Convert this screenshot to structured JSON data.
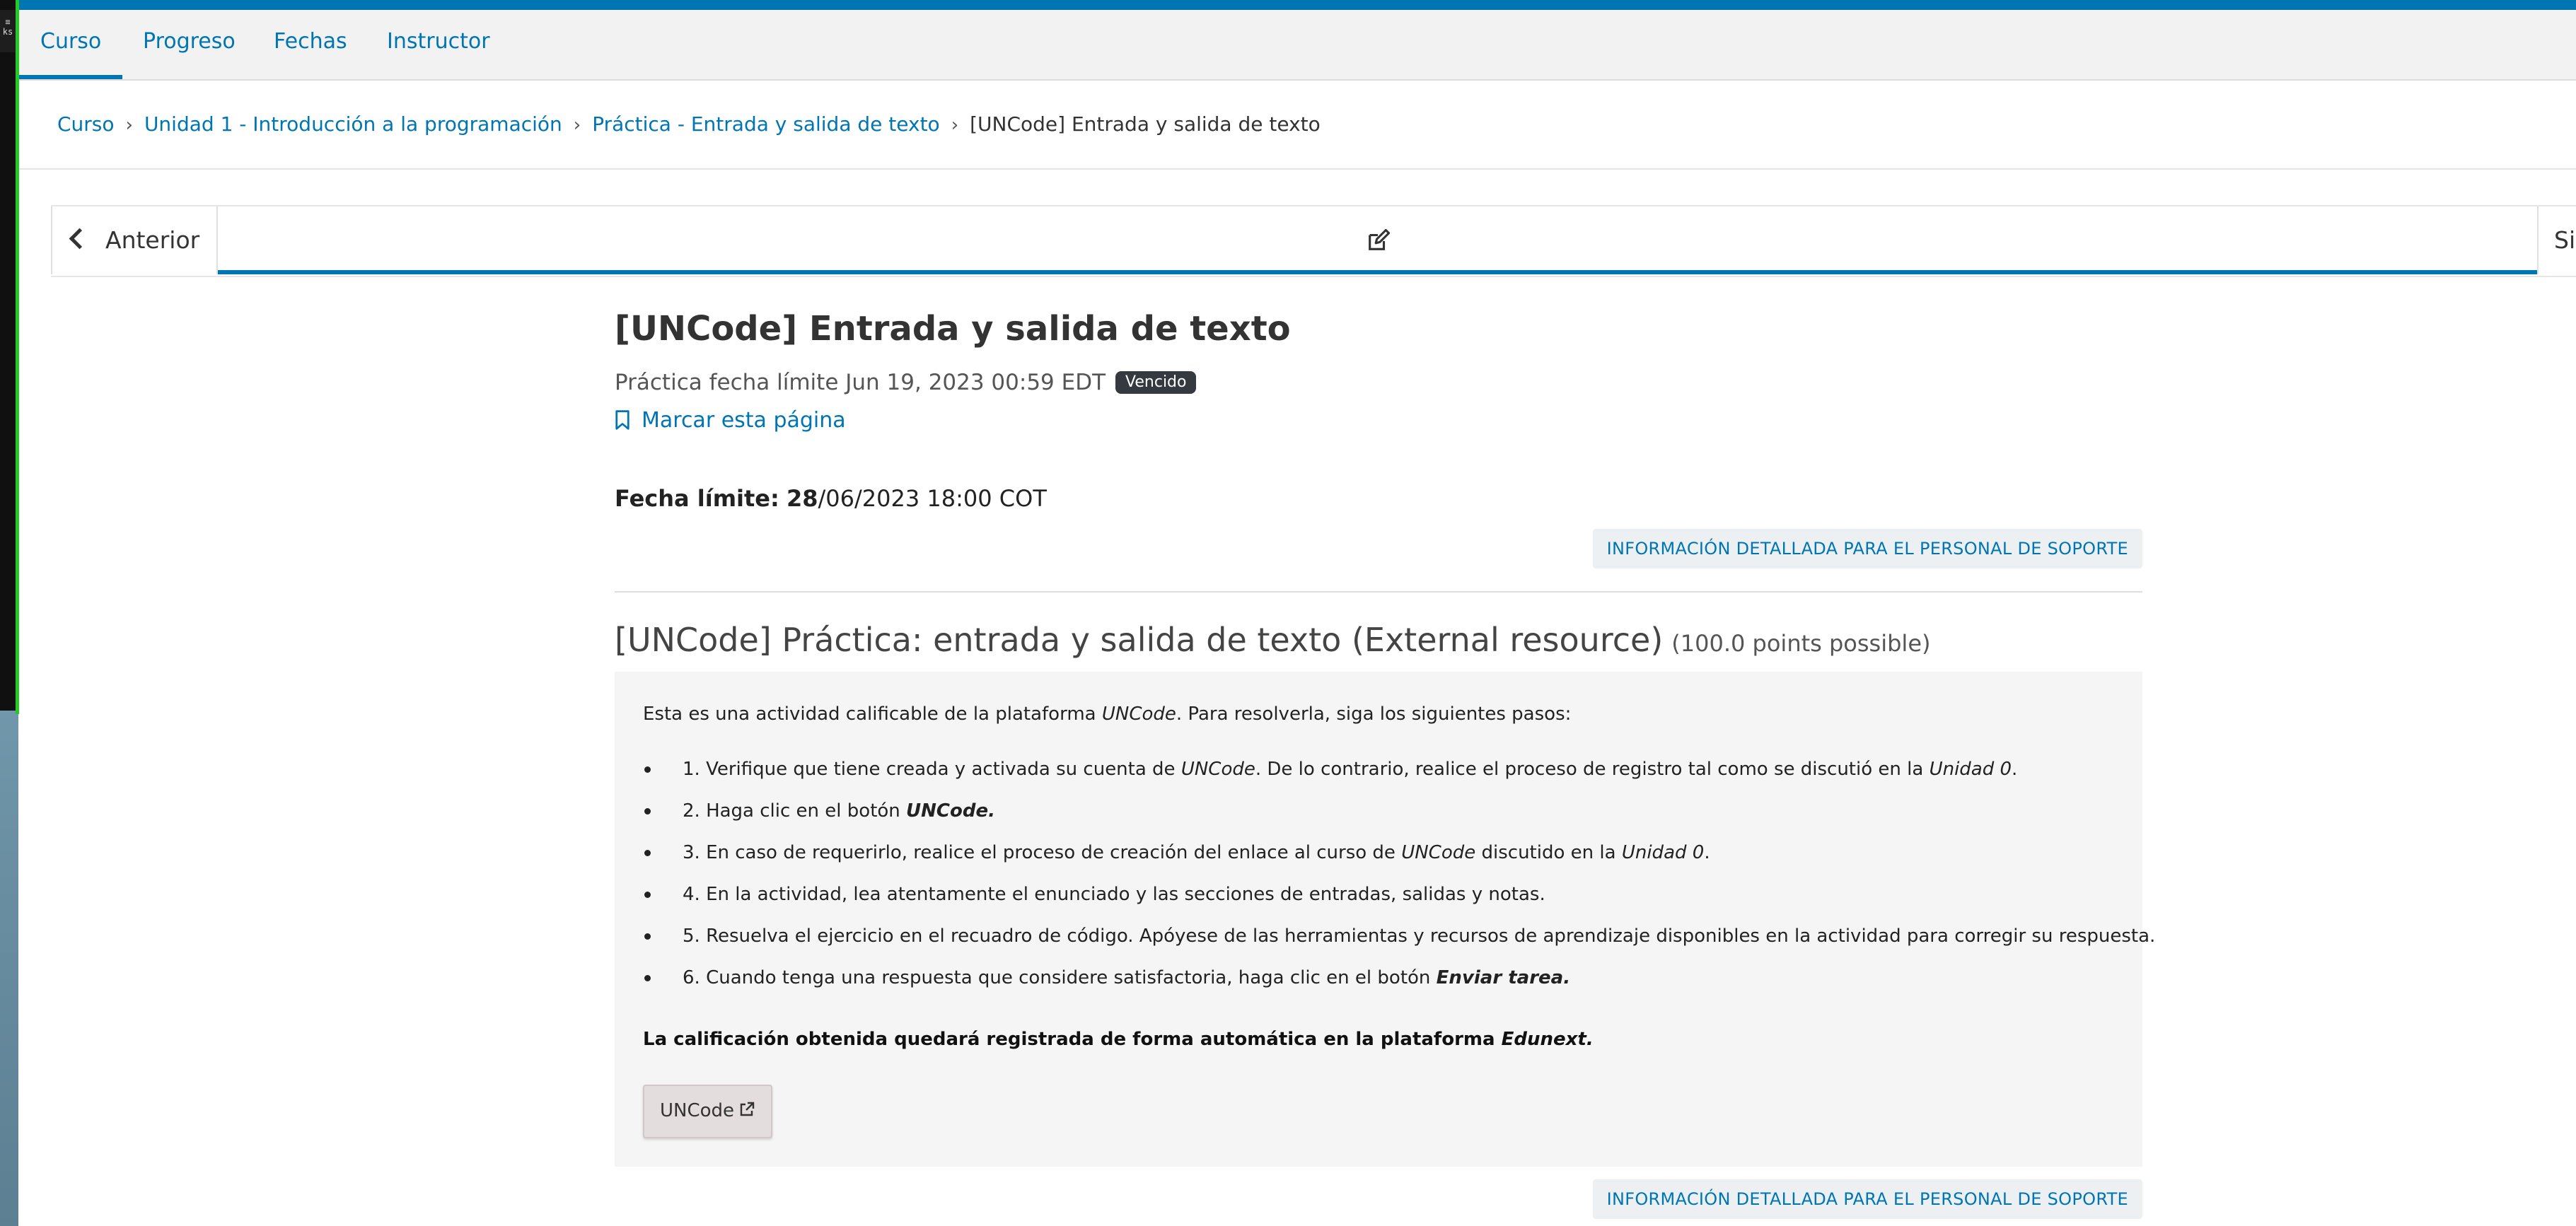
{
  "desktop": {
    "tray_icon_text": "≡\nks"
  },
  "course_nav": {
    "tabs": [
      {
        "label": "Curso",
        "active": true
      },
      {
        "label": "Progreso",
        "active": false
      },
      {
        "label": "Fechas",
        "active": false
      },
      {
        "label": "Instructor",
        "active": false
      }
    ]
  },
  "breadcrumb": {
    "items": [
      "Curso",
      "Unidad 1 - Introducción a la programación",
      "Práctica - Entrada y salida de texto"
    ],
    "current": "[UNCode] Entrada y salida de texto",
    "separator": "›"
  },
  "sequence_nav": {
    "prev_label": "Anterior",
    "next_label": "Siguiente",
    "unit_icon": "edit-icon"
  },
  "unit": {
    "title": "[UNCode] Entrada y salida de texto",
    "due_text": "Práctica fecha límite Jun 19, 2023 00:59 EDT",
    "badge": "Vencido",
    "bookmark_label": "Marcar esta página",
    "deadline_label": "Fecha límite:",
    "deadline_day": "28",
    "deadline_rest": "/06/2023 18:00 COT",
    "staff_debug_label": "INFORMACIÓN DETALLADA PARA EL PERSONAL DE SOPORTE"
  },
  "component": {
    "title": "[UNCode] Práctica: entrada y salida de texto (External resource)",
    "points": "(100.0 points possible)",
    "intro_1": "Esta es una actividad calificable de la plataforma ",
    "intro_platform": "UNCode",
    "intro_2": ". Para resolverla, siga los siguientes pasos:",
    "steps": {
      "s1_a": "1. Verifique que tiene creada y activada su cuenta de ",
      "s1_b": "UNCode",
      "s1_c": ". De lo contrario, realice el proceso de registro tal como se discutió en la ",
      "s1_d": "Unidad 0",
      "s1_e": ".",
      "s2_a": "2. Haga clic en el botón ",
      "s2_b": "UNCode.",
      "s3_a": "3. En caso de requerirlo, realice el proceso de creación del enlace al curso de ",
      "s3_b": "UNCode",
      "s3_c": " discutido en la ",
      "s3_d": "Unidad 0",
      "s3_e": ".",
      "s4": "4. En la actividad, lea atentamente el enunciado y las secciones de entradas, salidas y notas.",
      "s5": "5. Resuelva el ejercicio en el recuadro de código. Apóyese de las herramientas y recursos de aprendizaje disponibles en la actividad para corregir su respuesta.",
      "s6_a": "6. Cuando tenga una respuesta que considere satisfactoria, haga clic en el botón ",
      "s6_b": "Enviar tarea."
    },
    "final_note_a": "La calificación obtenida quedará registrada de forma automática en la plataforma ",
    "final_note_b": "Edunext.",
    "launch_button": "UNCode"
  },
  "colors": {
    "brand_blue": "#0075b4",
    "badge_bg": "#343a40",
    "box_bg": "#f5f5f5"
  }
}
